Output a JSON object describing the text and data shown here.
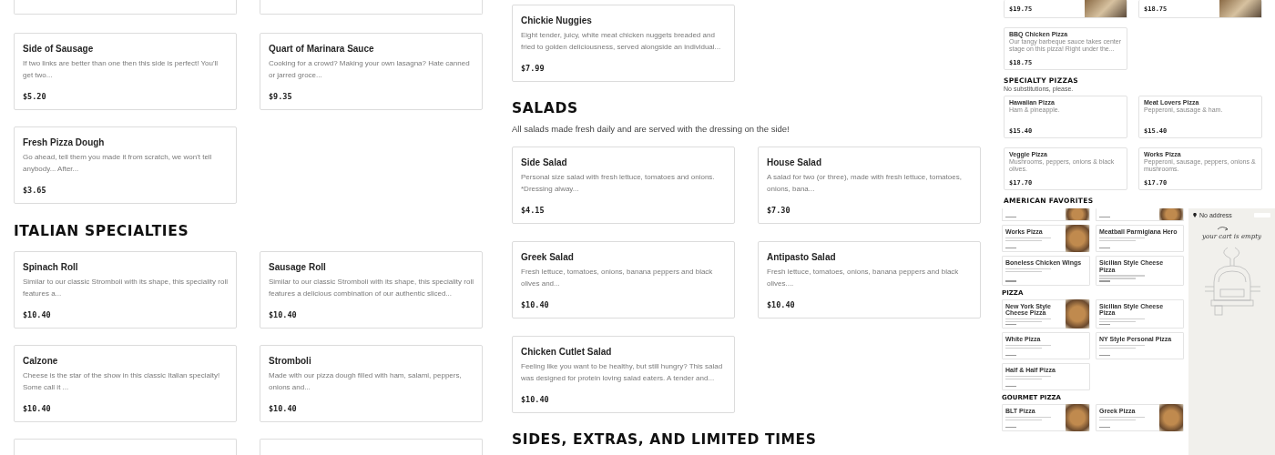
{
  "menu_columns": [
    {
      "sections": [
        {
          "items": [
            {
              "title": "Side of Sausage",
              "description": "If two links are better than one then this side is perfect! You'll get two...",
              "price": "$5.20"
            },
            {
              "title": "Quart of Marinara Sauce",
              "description": "Cooking for a crowd? Making your own lasagna? Hate canned or jarred groce...",
              "price": "$9.35"
            },
            {
              "title": "Fresh Pizza Dough",
              "description": "Go ahead, tell them you made it from scratch, we won't tell anybody... After...",
              "price": "$3.65"
            }
          ]
        },
        {
          "heading": "ITALIAN SPECIALTIES",
          "items": [
            {
              "title": "Spinach Roll",
              "description": "Similar to our classic Stromboli with its shape, this speciality roll features a...",
              "price": "$10.40"
            },
            {
              "title": "Sausage Roll",
              "description": "Similar to our classic Stromboli with its shape, this speciality roll features a delicious combination of our authentic sliced...",
              "price": "$10.40"
            },
            {
              "title": "Calzone",
              "description": "Cheese is the star of the show in this classic Italian specialty! Some call it ...",
              "price": "$10.40"
            },
            {
              "title": "Stromboli",
              "description": "Made with our pizza dough filled with ham, salami, peppers, onions and...",
              "price": "$10.40"
            }
          ]
        }
      ]
    },
    {
      "sections": [
        {
          "items": [
            {
              "title": "Chickie Nuggies",
              "description": "Eight tender, juicy, white meat chicken nuggets breaded and fried to golden deliciousness, served alongside an individual...",
              "price": "$7.99"
            }
          ]
        },
        {
          "heading": "SALADS",
          "subtitle": "All salads made fresh daily and are served with the dressing on the side!",
          "items": [
            {
              "title": "Side Salad",
              "description": "Personal size salad with fresh lettuce, tomatoes and onions. *Dressing alway...",
              "price": "$4.15"
            },
            {
              "title": "House Salad",
              "description": "A salad for two (or three), made with fresh lettuce, tomatoes, onions, bana...",
              "price": "$7.30"
            },
            {
              "title": "Greek Salad",
              "description": "Fresh lettuce, tomatoes, onions, banana peppers and black olives and...",
              "price": "$10.40"
            },
            {
              "title": "Antipasto Salad",
              "description": "Fresh lettuce, tomatoes, onions, banana peppers and black olives....",
              "price": "$10.40"
            },
            {
              "title": "Chicken Cutlet Salad",
              "description": "Feeling like you want to be healthy, but still hungry? This salad was designed for protein loving salad eaters. A tender and...",
              "price": "$10.40"
            }
          ]
        },
        {
          "heading": "SIDES, EXTRAS, AND LIMITED TIMES"
        }
      ]
    }
  ],
  "preview": {
    "top_sections": [
      {
        "items": [
          {
            "price": "$19.75",
            "photo": true
          },
          {
            "price": "$18.75",
            "photo": true
          },
          {
            "title": "BBQ Chicken Pizza",
            "description": "Our tangy barbeque sauce takes center stage on this pizza! Right under the...",
            "price": "$18.75"
          }
        ]
      },
      {
        "heading": "SPECIALTY PIZZAS",
        "subtitle": "No substitutions, please.",
        "items": [
          {
            "title": "Hawaiian Pizza",
            "description": "Ham & pineapple.",
            "price": "$15.40"
          },
          {
            "title": "Meat Lovers Pizza",
            "description": "Pepperoni, sausage & ham.",
            "price": "$15.40"
          },
          {
            "title": "Veggie Pizza",
            "description": "Mushrooms, peppers, onions & black olives.",
            "price": "$17.70"
          },
          {
            "title": "Works Pizza",
            "description": "Pepperoni, sausage, peppers, onions & mushrooms.",
            "price": "$17.70"
          }
        ]
      },
      {
        "heading": "AMERICAN FAVORITES"
      }
    ],
    "bottom_sections": [
      {
        "items": [
          {
            "photo": true
          },
          {
            "photo": true
          },
          {
            "title": "Works Pizza",
            "photo": true
          },
          {
            "title": "Meatball Parmigiana Hero"
          },
          {
            "title": "Boneless Chicken Wings"
          },
          {
            "title": "Sicilian Style Cheese Pizza"
          }
        ]
      },
      {
        "heading": "PIZZA",
        "items": [
          {
            "title": "New York Style Cheese Pizza",
            "photo": true
          },
          {
            "title": "Sicilian Style Cheese Pizza"
          },
          {
            "title": "White Pizza"
          },
          {
            "title": "NY Style Personal Pizza"
          },
          {
            "title": "Half & Half Pizza"
          }
        ]
      },
      {
        "heading": "GOURMET PIZZA",
        "items": [
          {
            "title": "BLT Pizza",
            "photo": true
          },
          {
            "title": "Greek Pizza",
            "photo": true
          }
        ]
      }
    ],
    "cart": {
      "address": "No address",
      "message": "your cart is empty"
    }
  }
}
